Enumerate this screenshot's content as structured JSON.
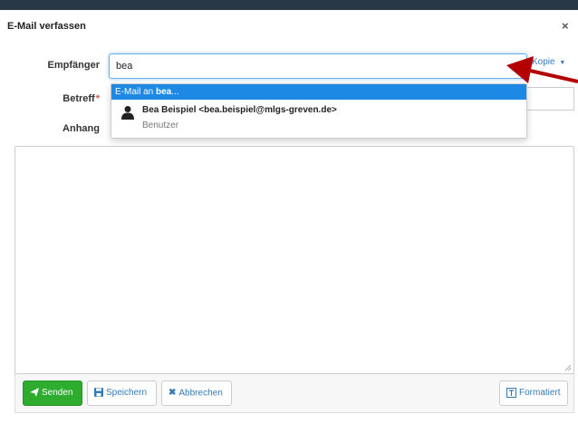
{
  "modal": {
    "title": "E-Mail verfassen",
    "close_label": "×"
  },
  "form": {
    "to_label": "Empfänger",
    "to_value": "bea",
    "kopie_label": "Kopie",
    "subject_label": "Betreff",
    "subject_required": "*",
    "attachment_label": "Anhang"
  },
  "dropdown": {
    "email_prefix": "E-Mail an ",
    "email_query": "bea",
    "email_suffix": "...",
    "user_name": "Bea Beispiel <bea.beispiel@mlgs-greven.de>",
    "user_role": "Benutzer",
    "user_icon": "user-icon"
  },
  "footer": {
    "send_label": "Senden",
    "save_label": "Speichern",
    "cancel_label": "Abbrechen",
    "format_label": "Formatiert"
  },
  "colors": {
    "accent": "#1e88e5",
    "send_green": "#2eac2e",
    "link_blue": "#337ab7",
    "annotation_arrow": "#b30000"
  }
}
